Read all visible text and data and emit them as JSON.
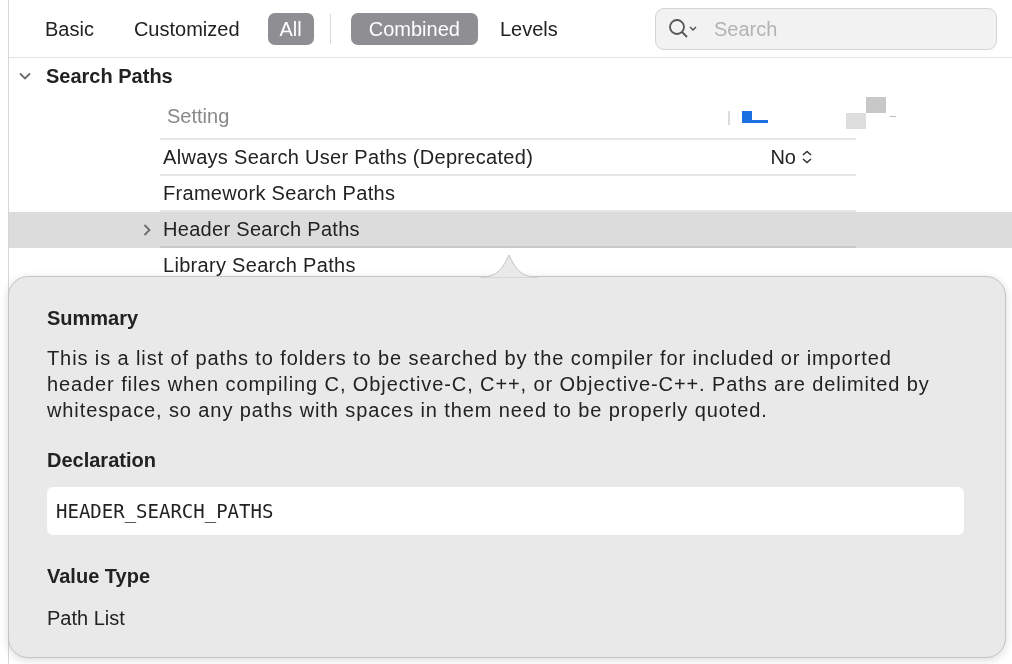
{
  "filter_tabs": [
    {
      "label": "Basic",
      "selected": false
    },
    {
      "label": "Customized",
      "selected": false
    },
    {
      "label": "All",
      "selected": true
    }
  ],
  "view_tabs": [
    {
      "label": "Combined",
      "selected": true
    },
    {
      "label": "Levels",
      "selected": false
    }
  ],
  "search": {
    "placeholder": "Search"
  },
  "section": {
    "title": "Search Paths",
    "expanded": true
  },
  "table": {
    "columns": [
      {
        "label": "Setting"
      }
    ],
    "rows": [
      {
        "name": "Always Search User Paths (Deprecated)",
        "value": "No",
        "kind": "popup",
        "selected": false
      },
      {
        "name": "Framework Search Paths",
        "kind": "plain",
        "selected": false
      },
      {
        "name": "Header Search Paths",
        "kind": "list",
        "expanded": false,
        "selected": true
      },
      {
        "name": "Library Search Paths",
        "kind": "plain",
        "selected": false
      }
    ]
  },
  "popover": {
    "summary_heading": "Summary",
    "summary": "This is a list of paths to folders to be searched by the compiler for included or imported header files when compiling C, Objective-C, C++, or Objective-C++. Paths are delimited by whitespace, so any paths with spaces in them need to be properly quoted.",
    "declaration_heading": "Declaration",
    "declaration": "HEADER_SEARCH_PATHS",
    "value_type_heading": "Value Type",
    "value_type": "Path List"
  }
}
